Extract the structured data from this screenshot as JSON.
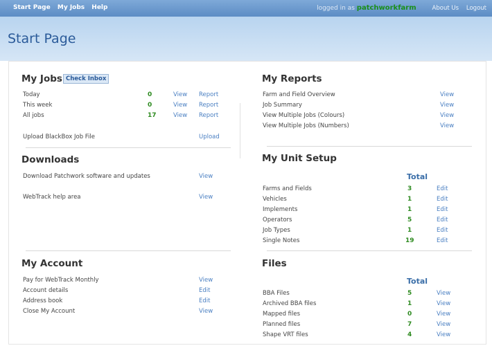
{
  "topbar": {
    "nav": [
      "Start Page",
      "My Jobs",
      "Help"
    ],
    "logged_in": "logged in as",
    "username": "patchworkfarm",
    "about": "About Us",
    "logout": "Logout"
  },
  "page_title": "Start Page",
  "my_jobs": {
    "heading": "My Jobs",
    "inbox": "Check Inbox",
    "rows": [
      {
        "label": "Today",
        "count": "0",
        "view": "View",
        "report": "Report"
      },
      {
        "label": "This week",
        "count": "0",
        "view": "View",
        "report": "Report"
      },
      {
        "label": "All jobs",
        "count": "17",
        "view": "View",
        "report": "Report"
      }
    ],
    "upload_label": "Upload BlackBox Job File",
    "upload_link": "Upload"
  },
  "downloads": {
    "heading": "Downloads",
    "rows": [
      {
        "label": "Download Patchwork software and updates",
        "link": "View"
      },
      {
        "label": "WebTrack help area",
        "link": "View"
      }
    ]
  },
  "my_account": {
    "heading": "My Account",
    "rows": [
      {
        "label": "Pay for WebTrack Monthly",
        "link": "View"
      },
      {
        "label": "Account details",
        "link": "Edit"
      },
      {
        "label": "Address book",
        "link": "Edit"
      },
      {
        "label": "Close My Account",
        "link": "View"
      }
    ]
  },
  "my_reports": {
    "heading": "My Reports",
    "rows": [
      {
        "label": "Farm and Field Overview",
        "link": "View"
      },
      {
        "label": "Job Summary",
        "link": "View"
      },
      {
        "label": "View Multiple Jobs (Colours)",
        "link": "View"
      },
      {
        "label": "View Multiple Jobs (Numbers)",
        "link": "View"
      }
    ]
  },
  "unit_setup": {
    "heading": "My Unit Setup",
    "total": "Total",
    "rows": [
      {
        "label": "Farms and Fields",
        "count": "3",
        "link": "Edit"
      },
      {
        "label": "Vehicles",
        "count": "1",
        "link": "Edit"
      },
      {
        "label": "Implements",
        "count": "1",
        "link": "Edit"
      },
      {
        "label": "Operators",
        "count": "5",
        "link": "Edit"
      },
      {
        "label": "Job Types",
        "count": "1",
        "link": "Edit"
      },
      {
        "label": "Single Notes",
        "count": "19",
        "link": "Edit"
      }
    ]
  },
  "files": {
    "heading": "Files",
    "total": "Total",
    "rows": [
      {
        "label": "BBA Files",
        "count": "5",
        "link": "View"
      },
      {
        "label": "Archived BBA files",
        "count": "1",
        "link": "View"
      },
      {
        "label": "Mapped files",
        "count": "0",
        "link": "View"
      },
      {
        "label": "Planned files",
        "count": "7",
        "link": "View"
      },
      {
        "label": "Shape VRT files",
        "count": "4",
        "link": "View"
      }
    ]
  }
}
